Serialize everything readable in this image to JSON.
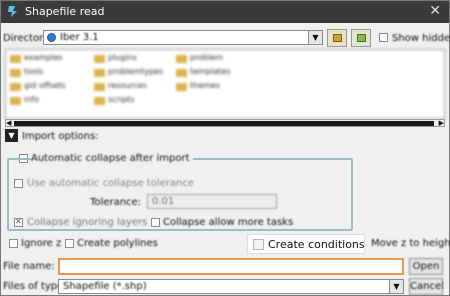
{
  "window": {
    "title": "Shapefile read",
    "close_glyph": "✕"
  },
  "directory": {
    "label": "Directory:",
    "value": "Iber 3.1",
    "arrow": "▼",
    "show_hidden_label": "Show hidden"
  },
  "file_list": [
    "examples",
    "plugins",
    "problem",
    "tools",
    "problemtypes",
    "templates",
    "gid offsets",
    "resources",
    "themes",
    "info",
    "scripts"
  ],
  "import_options": {
    "toggle_glyph": "▼",
    "label": "Import options:",
    "auto_collapse_label": "Automatic collapse after import",
    "use_auto_tolerance_label": "Use automatic collapse tolerance",
    "tolerance_label": "Tolerance:",
    "tolerance_value": "0.01",
    "collapse_ignoring_layers_label": "Collapse ignoring layers",
    "collapse_allow_more_tasks_label": "Collapse allow more tasks"
  },
  "bottom_options": {
    "ignore_z_label": "Ignore z",
    "create_polylines_label": "Create polylines",
    "create_conditions_label": "Create conditions",
    "move_z_label": "Move z to height"
  },
  "file_name": {
    "label": "File name:",
    "value": "",
    "open_label": "Open"
  },
  "file_type": {
    "label": "Files of type:",
    "value": "Shapefile (*.shp)",
    "arrow": "▼",
    "cancel_label": "Cancel"
  }
}
